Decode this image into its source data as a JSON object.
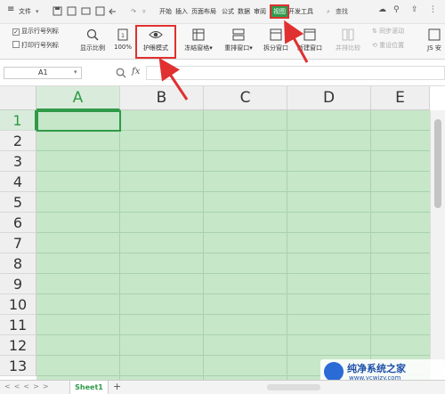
{
  "menubar": {
    "hamburger": "≡",
    "file": "文件",
    "tabs": [
      "开始",
      "插入",
      "页面布局",
      "公式",
      "数据",
      "审阅",
      "视图",
      "开发工具"
    ],
    "active_tab": "视图",
    "search": "查找"
  },
  "ribbon": {
    "show_row_col": "显示行号列标",
    "print_row_col": "打印行号列标",
    "show_ratio": "显示比例",
    "zoom_100": "100%",
    "eye_mode": "护眼模式",
    "freeze": "冻结窗格",
    "arrange": "重排窗口",
    "split": "拆分窗口",
    "new_window": "新建窗口",
    "side_by_side": "并排比较",
    "sync_scroll": "同步滚动",
    "reset_position": "重设位置",
    "js": "JS 安"
  },
  "formula_bar": {
    "cell_ref": "A1",
    "fx": "fx"
  },
  "columns": [
    "A",
    "B",
    "C",
    "D",
    "E"
  ],
  "rows": [
    "1",
    "2",
    "3",
    "4",
    "5",
    "6",
    "7",
    "8",
    "9",
    "10",
    "11",
    "12",
    "13"
  ],
  "sheet_tab": "Sheet1",
  "add_sheet": "+",
  "watermark": {
    "line1": "纯净系统之家",
    "line2": "www.ycwjzy.com"
  },
  "colors": {
    "eye_mode_cells": "#c6e7c8",
    "active_green": "#2f9a47",
    "annotation_red": "#e03030"
  }
}
